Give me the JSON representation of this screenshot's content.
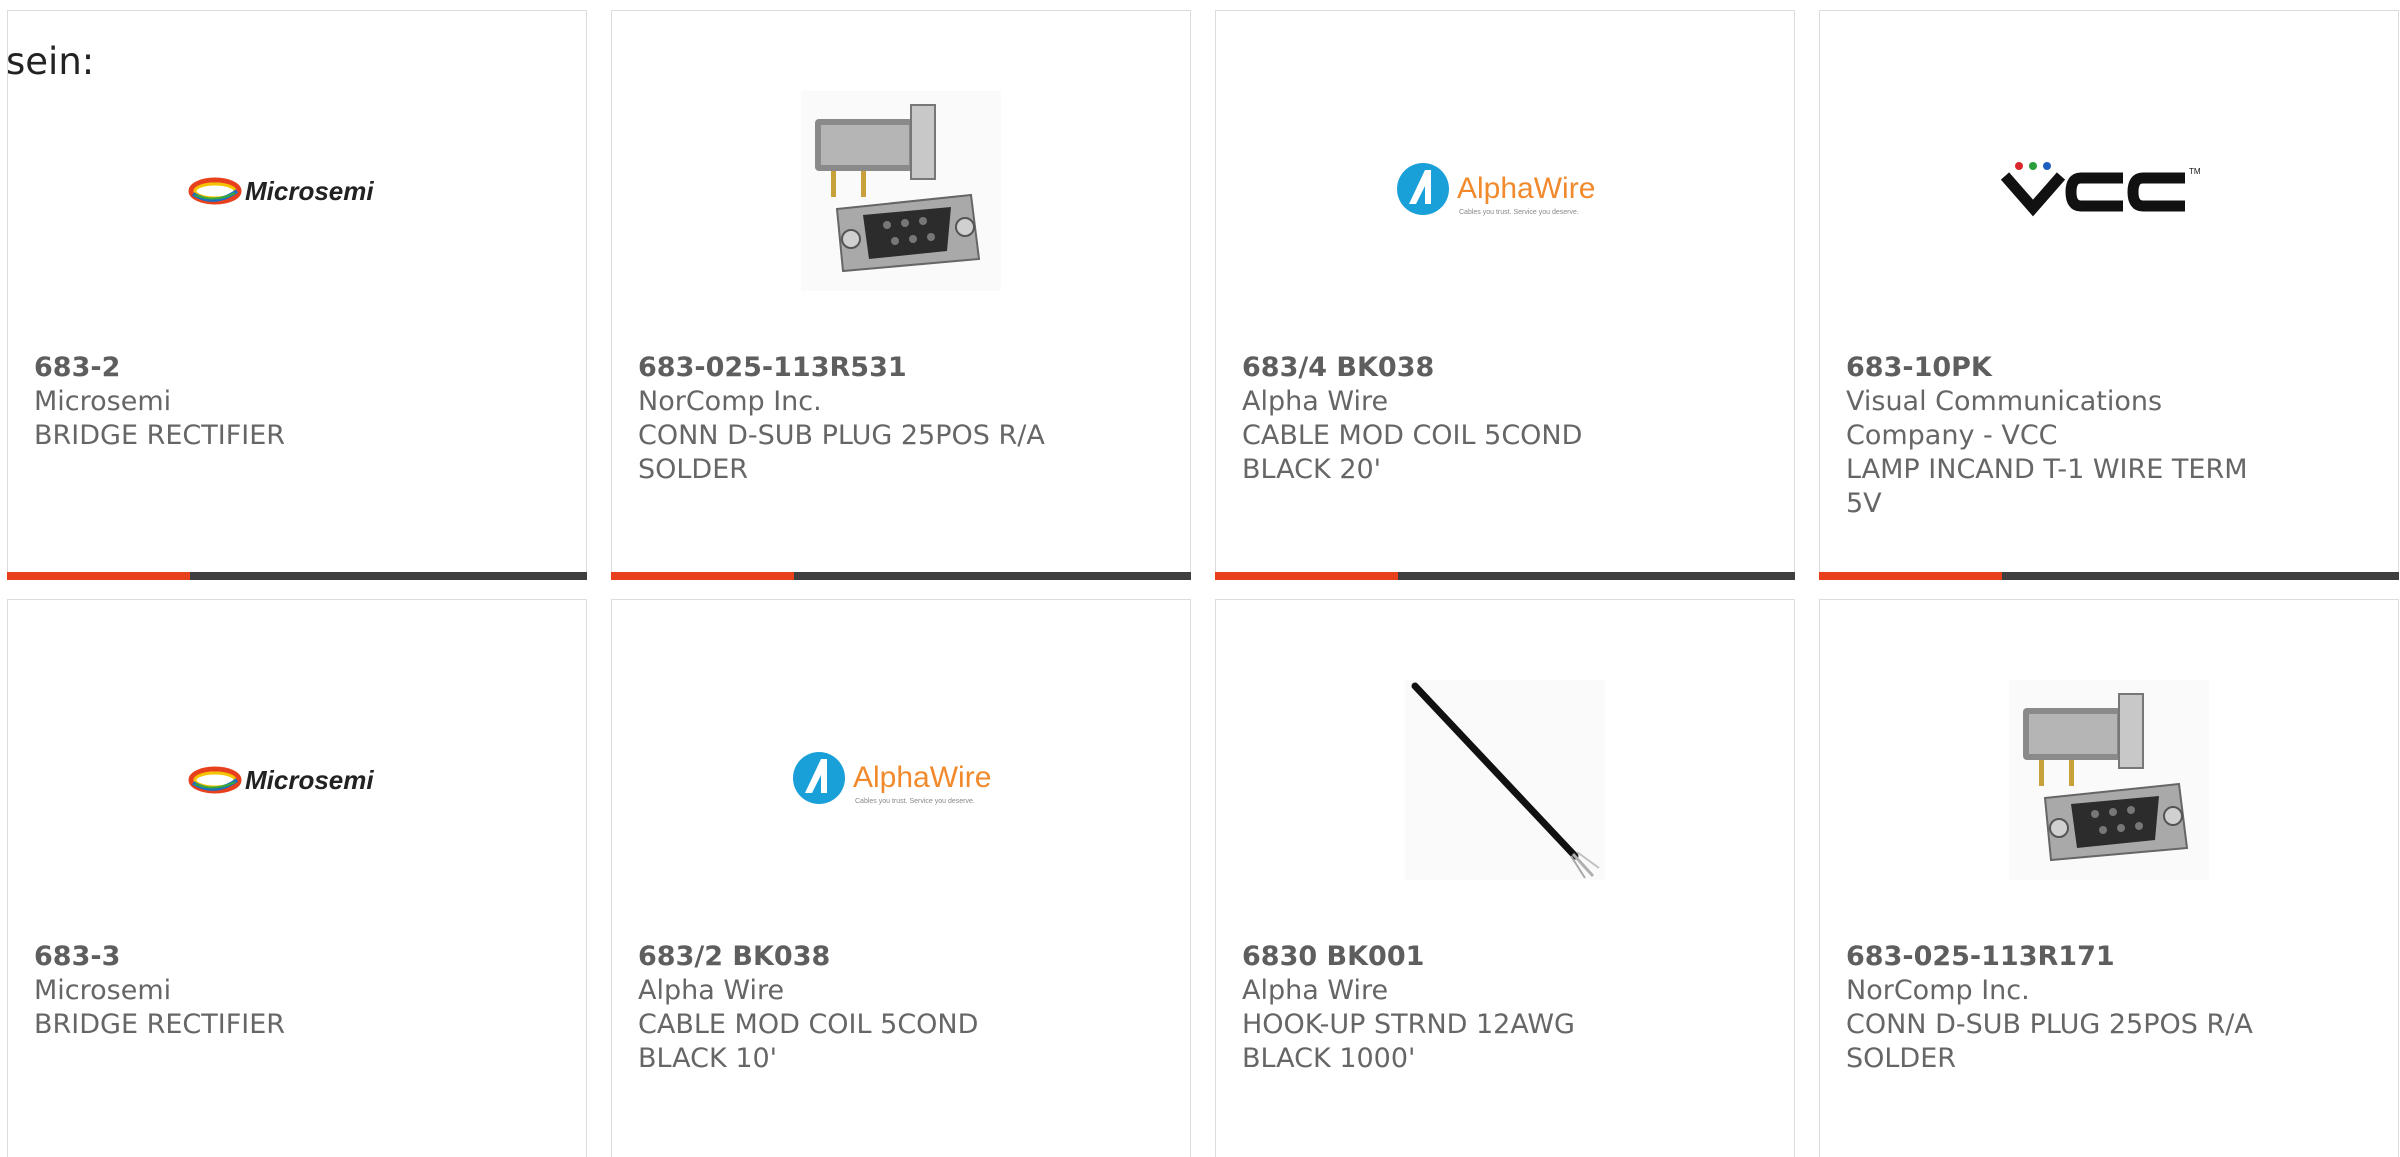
{
  "intro_text": "sein:",
  "products": [
    {
      "part_number": "683-2",
      "manufacturer": "Microsemi",
      "description": "BRIDGE RECTIFIER",
      "image": "microsemi-logo",
      "logo_text": "Microsemi"
    },
    {
      "part_number": "683-025-113R531",
      "manufacturer": "NorComp Inc.",
      "description": "CONN D-SUB PLUG 25POS R/A SOLDER",
      "image": "dsub-connector-photo"
    },
    {
      "part_number": "683/4 BK038",
      "manufacturer": "Alpha Wire",
      "description": "CABLE MOD COIL 5COND BLACK 20'",
      "image": "alphawire-logo",
      "logo_text": "AlphaWire",
      "logo_tagline": "Cables you trust. Service you deserve."
    },
    {
      "part_number": "683-10PK",
      "manufacturer": "Visual Communications Company - VCC",
      "description": "LAMP INCAND T-1 WIRE TERM 5V",
      "image": "vcc-logo",
      "logo_text": "VCC"
    },
    {
      "part_number": "683-3",
      "manufacturer": "Microsemi",
      "description": "BRIDGE RECTIFIER",
      "image": "microsemi-logo",
      "logo_text": "Microsemi"
    },
    {
      "part_number": "683/2 BK038",
      "manufacturer": "Alpha Wire",
      "description": "CABLE MOD COIL 5COND BLACK 10'",
      "image": "alphawire-logo",
      "logo_text": "AlphaWire",
      "logo_tagline": "Cables you trust. Service you deserve."
    },
    {
      "part_number": "6830 BK001",
      "manufacturer": "Alpha Wire",
      "description": "HOOK-UP STRND 12AWG BLACK 1000'",
      "image": "black-wire-photo"
    },
    {
      "part_number": "683-025-113R171",
      "manufacturer": "NorComp Inc.",
      "description": "CONN D-SUB PLUG 25POS R/A SOLDER",
      "image": "dsub-connector-photo"
    }
  ],
  "colors": {
    "accent": "#e8401c",
    "bar": "#3f3f3f",
    "text": "#666666",
    "alphawire_blue": "#1aa0d8",
    "alphawire_orange": "#f08a2c"
  }
}
